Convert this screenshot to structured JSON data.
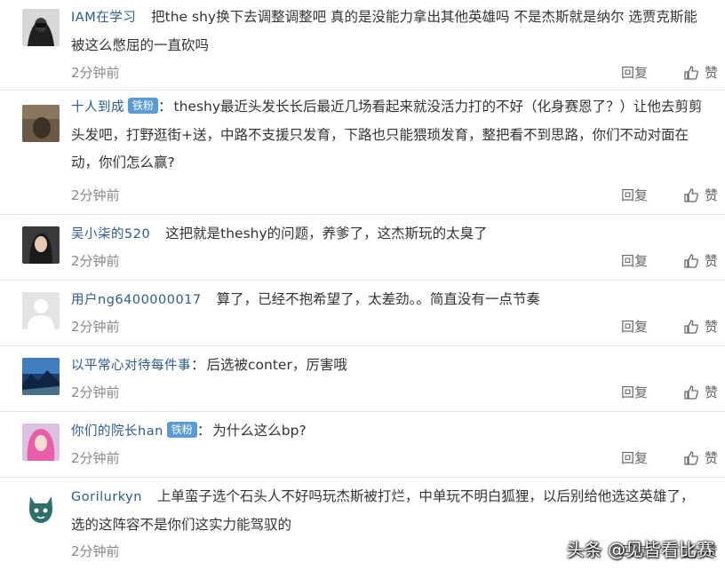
{
  "comments": [
    {
      "username": "IAM在学习",
      "badge": "",
      "separator": "",
      "text": "把the shy换下去调整调整吧 真的是没能力拿出其他英雄吗 不是杰斯就是纳尔 选贾克斯能被这么憋屈的一直砍吗",
      "time": "2分钟前",
      "reply_label": "回复",
      "like_label": "赞",
      "avatar_icon": "dark-hoodie-avatar"
    },
    {
      "username": "十人到成",
      "badge": "铁粉",
      "separator": "：",
      "text": "theshy最近头发长长后最近几场看起来就没活力打的不好（化身赛恩了？）让他去剪剪头发吧，打野逛街+送，中路不支援只发育，下路也只能猥琐发育，整把看不到思路，你们不动对面在动，你们怎么赢?",
      "time": "2分钟前",
      "reply_label": "回复",
      "like_label": "赞",
      "avatar_icon": "brown-photo-avatar"
    },
    {
      "username": "吴小柒的520",
      "badge": "",
      "separator": "",
      "text": "这把就是theshy的问题，养爹了，这杰斯玩的太臭了",
      "time": "2分钟前",
      "reply_label": "回复",
      "like_label": "赞",
      "avatar_icon": "girl-portrait-avatar"
    },
    {
      "username": "用户ng6400000017",
      "badge": "",
      "separator": "",
      "text": "算了，已经不抱希望了，太差劲。。简直没有一点节奏",
      "time": "2分钟前",
      "reply_label": "回复",
      "like_label": "赞",
      "avatar_icon": "default-user-avatar"
    },
    {
      "username": "以平常心对待每件事",
      "badge": "",
      "separator": "：",
      "text": "后选被conter，厉害哦",
      "time": "2分钟前",
      "reply_label": "回复",
      "like_label": "赞",
      "avatar_icon": "landscape-avatar"
    },
    {
      "username": "你们的院长han",
      "badge": "铁粉",
      "separator": "：",
      "text": "为什么这么bp?",
      "time": "2分钟前",
      "reply_label": "回复",
      "like_label": "赞",
      "avatar_icon": "pink-hair-avatar"
    },
    {
      "username": "Gorilurkyn",
      "badge": "",
      "separator": "",
      "text": "上单蛮子选个石头人不好吗玩杰斯被打烂，中单玩不明白狐狸，以后别给他选这英雄了，选的这阵容不是你们这实力能驾驭的",
      "time": "2分钟前",
      "reply_label": "回复",
      "like_label": "赞",
      "avatar_icon": "cartoon-cat-avatar"
    }
  ],
  "watermark": "头条 @见皆看比赛",
  "colors": {
    "username": "#2c5a8f",
    "badge": "#5b9bd5",
    "meta": "#888888",
    "divider": "#e6e6e6"
  }
}
